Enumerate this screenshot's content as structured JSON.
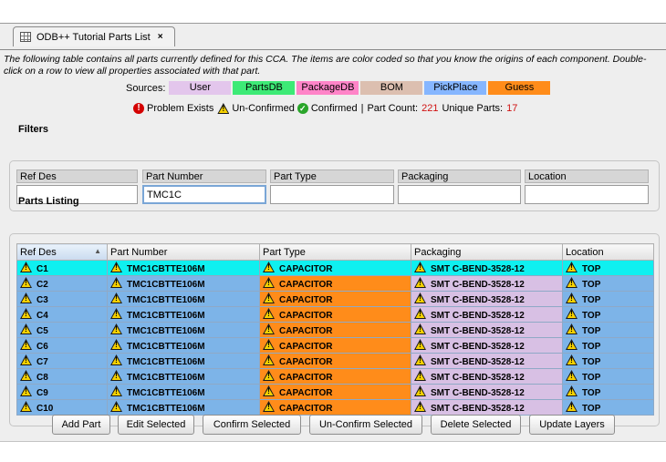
{
  "tab": {
    "title": "ODB++ Tutorial Parts List",
    "close": "×"
  },
  "description": "The following table contains all parts currently defined for this CCA. The items are color coded so that you know the origins of each component. Double-click on a row to view all properties associated with that part.",
  "sources": {
    "label": "Sources:",
    "items": [
      {
        "label": "User",
        "color": "#e3c6ec"
      },
      {
        "label": "PartsDB",
        "color": "#3dea76"
      },
      {
        "label": "PackageDB",
        "color": "#ff84c8"
      },
      {
        "label": "BOM",
        "color": "#dcbfb0"
      },
      {
        "label": "PickPlace",
        "color": "#86b6ff"
      },
      {
        "label": "Guess",
        "color": "#ff8c1a"
      }
    ]
  },
  "legend": {
    "problem": "Problem Exists",
    "unconfirmed": "Un-Confirmed",
    "confirmed": "Confirmed",
    "separator": "|",
    "part_count_label": "Part Count:",
    "part_count": "221",
    "unique_label": "Unique Parts:",
    "unique": "17"
  },
  "filters": {
    "title": "Filters",
    "fields": [
      {
        "label": "Ref Des",
        "value": ""
      },
      {
        "label": "Part Number",
        "value": "TMC1C"
      },
      {
        "label": "Part Type",
        "value": ""
      },
      {
        "label": "Packaging",
        "value": ""
      },
      {
        "label": "Location",
        "value": ""
      }
    ]
  },
  "listing": {
    "title": "Parts Listing",
    "columns": [
      "Ref Des",
      "Part Number",
      "Part Type",
      "Packaging",
      "Location"
    ],
    "sort_indicator": "▲",
    "rows": [
      [
        "C1",
        "TMC1CBTTE106M",
        "CAPACITOR",
        "SMT C-BEND-3528-12",
        "TOP"
      ],
      [
        "C2",
        "TMC1CBTTE106M",
        "CAPACITOR",
        "SMT C-BEND-3528-12",
        "TOP"
      ],
      [
        "C3",
        "TMC1CBTTE106M",
        "CAPACITOR",
        "SMT C-BEND-3528-12",
        "TOP"
      ],
      [
        "C4",
        "TMC1CBTTE106M",
        "CAPACITOR",
        "SMT C-BEND-3528-12",
        "TOP"
      ],
      [
        "C5",
        "TMC1CBTTE106M",
        "CAPACITOR",
        "SMT C-BEND-3528-12",
        "TOP"
      ],
      [
        "C6",
        "TMC1CBTTE106M",
        "CAPACITOR",
        "SMT C-BEND-3528-12",
        "TOP"
      ],
      [
        "C7",
        "TMC1CBTTE106M",
        "CAPACITOR",
        "SMT C-BEND-3528-12",
        "TOP"
      ],
      [
        "C8",
        "TMC1CBTTE106M",
        "CAPACITOR",
        "SMT C-BEND-3528-12",
        "TOP"
      ],
      [
        "C9",
        "TMC1CBTTE106M",
        "CAPACITOR",
        "SMT C-BEND-3528-12",
        "TOP"
      ],
      [
        "C10",
        "TMC1CBTTE106M",
        "CAPACITOR",
        "SMT C-BEND-3528-12",
        "TOP"
      ]
    ]
  },
  "buttons": {
    "add": "Add Part",
    "edit": "Edit Selected",
    "confirm": "Confirm Selected",
    "unconfirm": "Un-Confirm Selected",
    "delete": "Delete Selected",
    "update": "Update Layers"
  }
}
